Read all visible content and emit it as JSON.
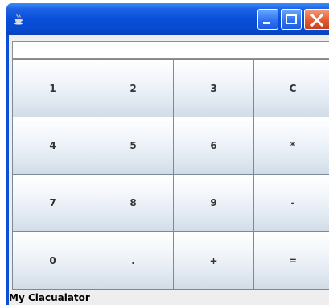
{
  "window": {
    "title": "",
    "app_icon": "java-cup-icon",
    "controls": {
      "minimize_icon": "minimize-icon",
      "maximize_icon": "maximize-icon",
      "close_icon": "close-icon"
    },
    "colors": {
      "titlebar": "#0a4ed8",
      "close_button": "#e45a2e"
    }
  },
  "display": {
    "value": ""
  },
  "keypad": {
    "rows": [
      [
        "1",
        "2",
        "3",
        "C"
      ],
      [
        "4",
        "5",
        "6",
        "*"
      ],
      [
        "7",
        "8",
        "9",
        "-"
      ],
      [
        "0",
        ".",
        "+",
        "="
      ]
    ]
  },
  "status": {
    "label": "My Clacualator"
  }
}
